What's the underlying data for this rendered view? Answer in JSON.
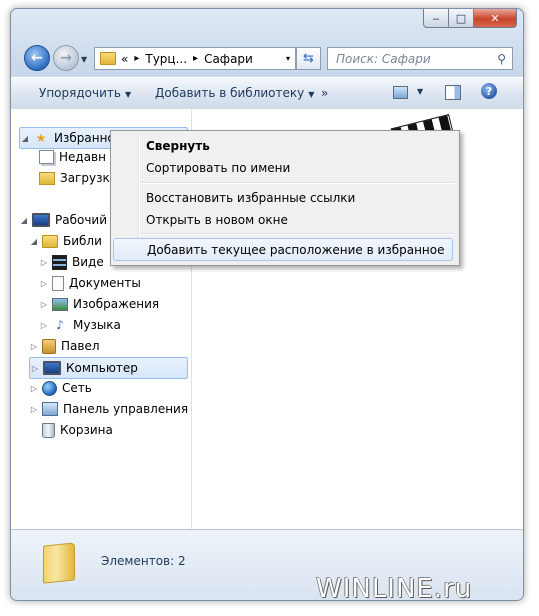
{
  "window": {
    "caption": {
      "min": "‒",
      "max": "□",
      "close": "✕"
    }
  },
  "address": {
    "overflow": "«",
    "crumbs": [
      "Турц...",
      "Сафари"
    ],
    "separator": "▸",
    "dropdown": "▾"
  },
  "search": {
    "placeholder": "Поиск: Сафари"
  },
  "toolbar": {
    "organize": "Упорядочить",
    "add_to_library": "Добавить в библиотеку",
    "more": "»",
    "help": "?"
  },
  "nav": {
    "favorites": "Избранное",
    "recent": "Недавн",
    "downloads": "Загрузк",
    "desktop": "Рабочий",
    "libraries": "Библи",
    "videos": "Виде",
    "documents": "Документы",
    "pictures": "Изображения",
    "music": "Музыка",
    "user": "Павел",
    "computer": "Компьютер",
    "network": "Сеть",
    "control_panel": "Панель управления",
    "recycle_bin": "Корзина"
  },
  "context_menu": {
    "collapse": "Свернуть",
    "sort_by_name": "Сортировать по имени",
    "restore_favorites": "Восстановить избранные ссылки",
    "open_new_window": "Открыть в новом окне",
    "add_current_location": "Добавить текущее расположение в избранное"
  },
  "details": {
    "items_count": "Элементов: 2"
  },
  "watermark": "WINLINE.ru"
}
